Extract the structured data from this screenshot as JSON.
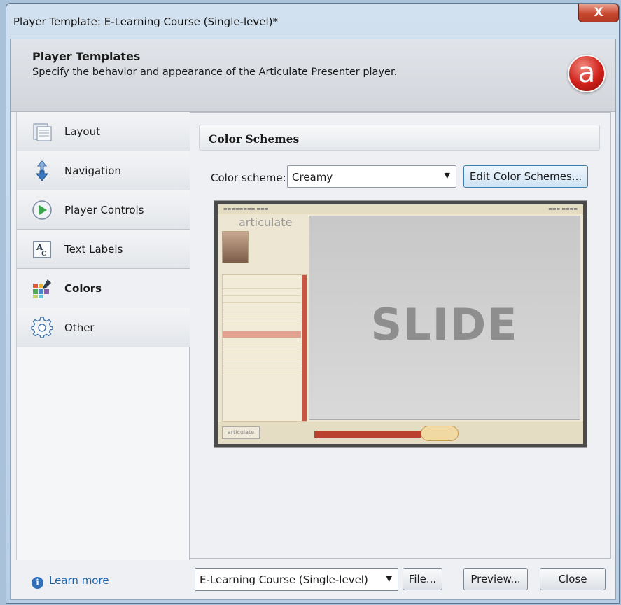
{
  "window": {
    "title": "Player Template: E-Learning Course (Single-level)*",
    "close_glyph": "X"
  },
  "header": {
    "title": "Player Templates",
    "description": "Specify the behavior and appearance of the Articulate Presenter player.",
    "logo_glyph": "a"
  },
  "sidebar": {
    "items": [
      {
        "label": "Layout",
        "icon": "layout-icon"
      },
      {
        "label": "Navigation",
        "icon": "navigation-icon"
      },
      {
        "label": "Player Controls",
        "icon": "player-controls-icon"
      },
      {
        "label": "Text Labels",
        "icon": "text-labels-icon"
      },
      {
        "label": "Colors",
        "icon": "colors-icon",
        "selected": true
      },
      {
        "label": "Other",
        "icon": "gear-icon"
      }
    ]
  },
  "main": {
    "section_title": "Color Schemes",
    "color_scheme_label": "Color scheme:",
    "color_scheme_value": "Creamy",
    "edit_button": "Edit Color Schemes...",
    "preview": {
      "slide_text": "SLIDE",
      "brand": "articulate",
      "bottom_logo": "articulate"
    }
  },
  "footer": {
    "learn_more": "Learn more",
    "template_value": "E-Learning Course (Single-level)",
    "file_button": "File...",
    "preview_button": "Preview...",
    "close_button": "Close"
  },
  "colors": {
    "accent": "#3c7fb1",
    "link": "#1e62a8",
    "logo_red": "#d0201a"
  }
}
